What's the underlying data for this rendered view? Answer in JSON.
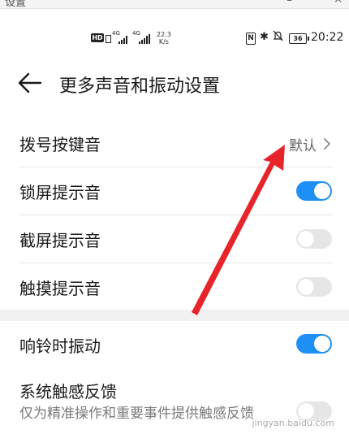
{
  "window": {
    "tab_title": "设置",
    "minimize_label": "–",
    "close_label": "×"
  },
  "status_bar": {
    "hd_label": "HD",
    "network_label_1": "4G",
    "network_label_2": "4G",
    "speed_value": "22.3",
    "speed_unit": "K/s",
    "nfc_label": "N",
    "bluetooth_glyph": "✱",
    "mute_glyph": "🔕",
    "battery_level": "36",
    "time": "20:22"
  },
  "header": {
    "title": "更多声音和振动设置"
  },
  "settings": {
    "dialpad": {
      "label": "拨号按键音",
      "value": "默认"
    },
    "lock_sound": {
      "label": "锁屏提示音",
      "enabled": true
    },
    "screenshot_sound": {
      "label": "截屏提示音",
      "enabled": false
    },
    "touch_sound": {
      "label": "触摸提示音",
      "enabled": false
    },
    "vibrate_ringing": {
      "label": "响铃时振动",
      "enabled": true
    },
    "haptic_feedback": {
      "label": "系统触感反馈",
      "description": "仅为精准操作和重要事件提供触感反馈",
      "enabled": false
    }
  },
  "annotation": {
    "color": "#e8242b"
  },
  "colors": {
    "accent": "#1e8ff5",
    "toggle_off": "#e6e6e6"
  },
  "watermark": "jingyan.baidu.com"
}
